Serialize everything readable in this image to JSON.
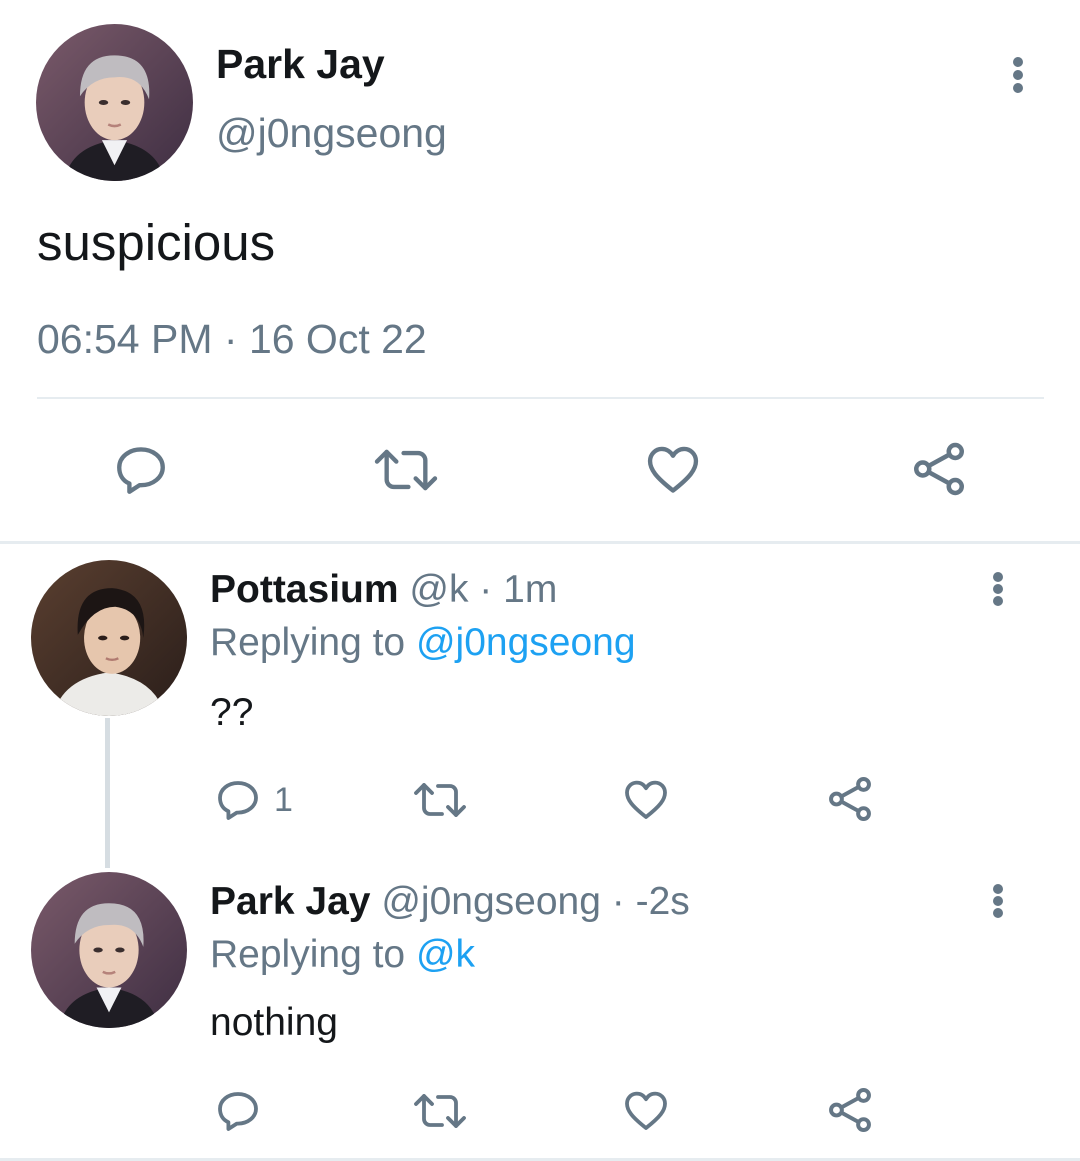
{
  "main_tweet": {
    "author_name": "Park Jay",
    "author_handle": "@j0ngseong",
    "text": "suspicious",
    "time": "06:54 PM",
    "separator": " · ",
    "date": "16 Oct 22",
    "menu_icon": "more-vertical-icon",
    "actions": [
      {
        "name": "reply",
        "icon": "reply-icon"
      },
      {
        "name": "retweet",
        "icon": "retweet-icon"
      },
      {
        "name": "like",
        "icon": "heart-icon"
      },
      {
        "name": "share",
        "icon": "share-icon"
      }
    ]
  },
  "replies": [
    {
      "author_name": "Pottasium",
      "author_handle": "@k",
      "dot": " · ",
      "time": "1m",
      "replying_prefix": "Replying to ",
      "replying_to": "@j0ngseong",
      "text": "??",
      "reply_count": "1"
    },
    {
      "author_name": "Park Jay",
      "author_handle": "@j0ngseong",
      "dot": " · ",
      "time": "-2s",
      "replying_prefix": "Replying to ",
      "replying_to": "@k",
      "text": "nothing",
      "reply_count": ""
    }
  ],
  "colors": {
    "text_primary": "#14171a",
    "text_secondary": "#657786",
    "link": "#1da1f2",
    "divider": "#e6ecf0",
    "icon": "#657786"
  }
}
